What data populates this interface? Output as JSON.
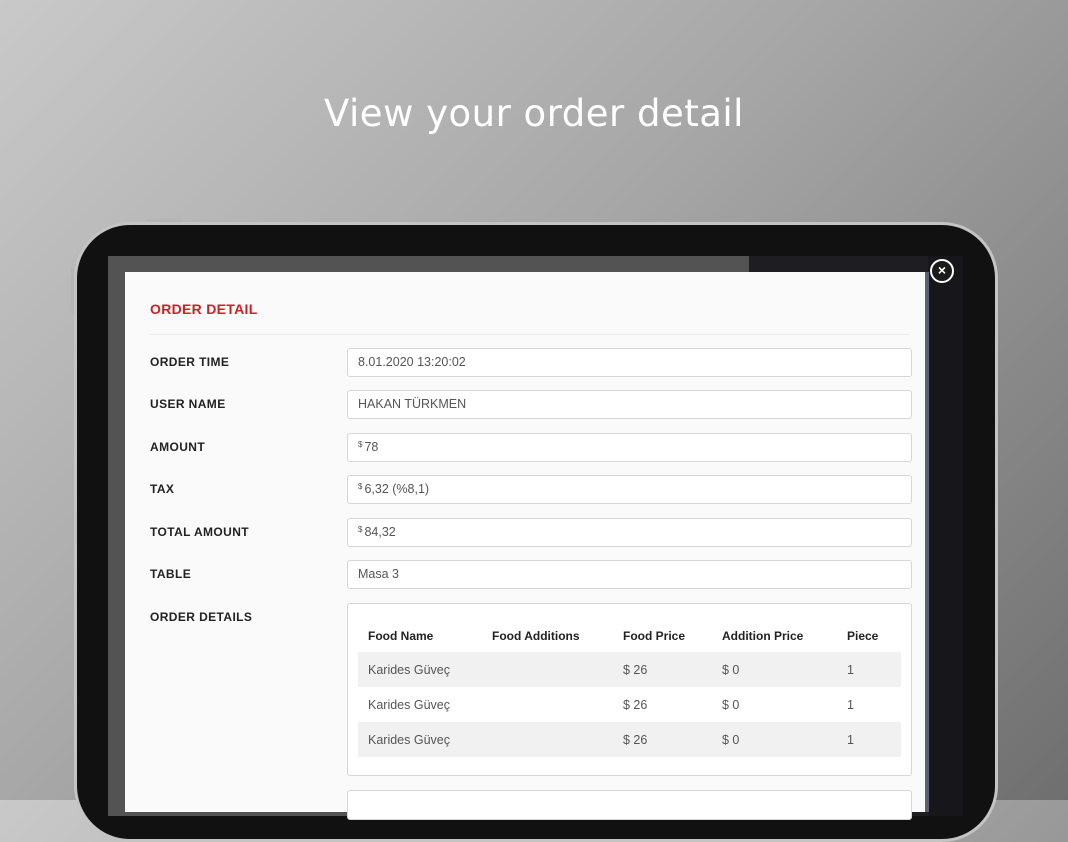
{
  "headline": "View your order detail",
  "modal": {
    "title": "ORDER DETAIL",
    "close_label": "×",
    "fields": {
      "order_time": {
        "label": "ORDER TIME",
        "value": "8.01.2020 13:20:02"
      },
      "user_name": {
        "label": "USER NAME",
        "value": "HAKAN TÜRKMEN"
      },
      "amount": {
        "label": "AMOUNT",
        "currency": "$",
        "value": "78"
      },
      "tax": {
        "label": "TAX",
        "currency": "$",
        "value": "6,32 (%8,1)"
      },
      "total_amount": {
        "label": "TOTAL AMOUNT",
        "currency": "$",
        "value": "84,32"
      },
      "table": {
        "label": "TABLE",
        "value": "Masa 3"
      }
    },
    "order_details": {
      "label": "ORDER DETAILS",
      "columns": [
        "Food Name",
        "Food Additions",
        "Food Price",
        "Addition Price",
        "Piece"
      ],
      "rows": [
        {
          "food_name": "Karides Güveç",
          "food_additions": "",
          "food_price": "$ 26",
          "addition_price": "$ 0",
          "piece": "1"
        },
        {
          "food_name": "Karides Güveç",
          "food_additions": "",
          "food_price": "$ 26",
          "addition_price": "$ 0",
          "piece": "1"
        },
        {
          "food_name": "Karides Güveç",
          "food_additions": "",
          "food_price": "$ 26",
          "addition_price": "$ 0",
          "piece": "1"
        }
      ]
    }
  },
  "colors": {
    "accent_red": "#cf1f25",
    "row_stripe": "#f1f1f1",
    "device_frame": "#111111"
  }
}
